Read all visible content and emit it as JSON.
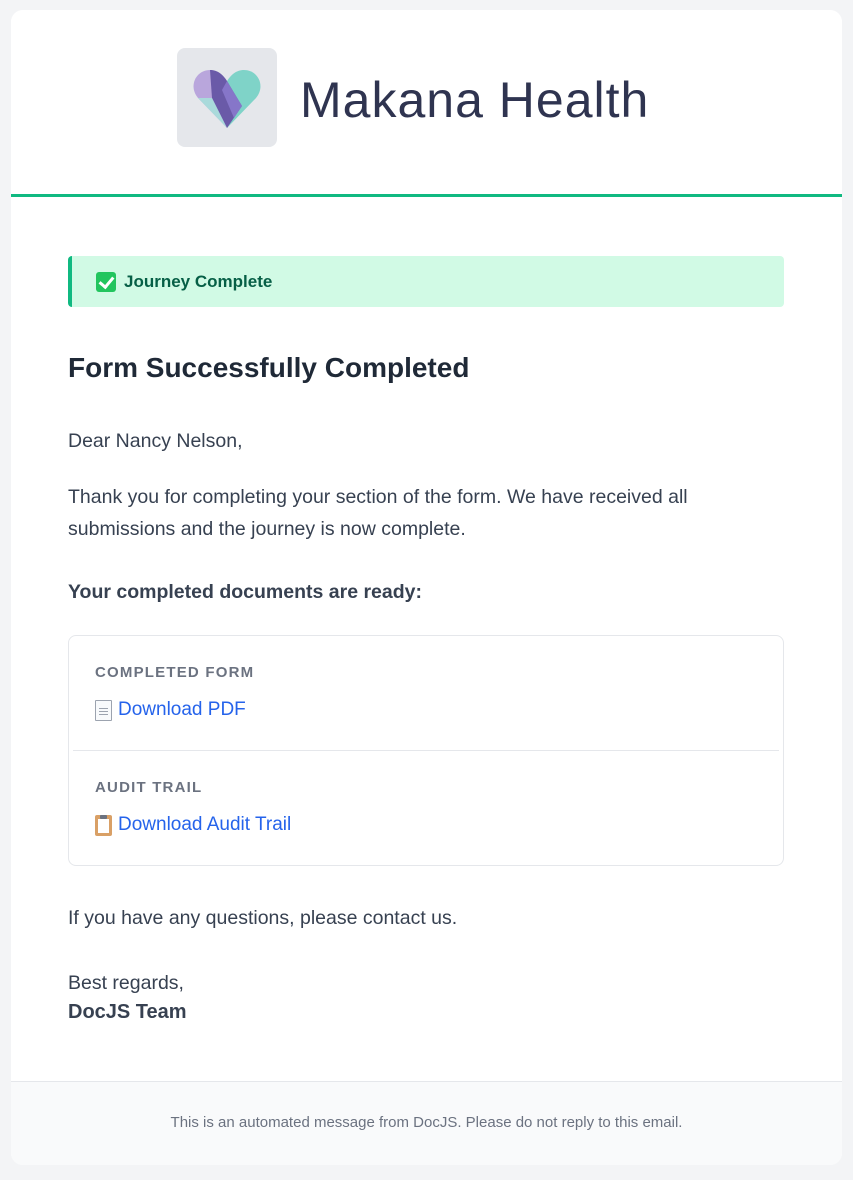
{
  "brand": {
    "name": "Makana Health",
    "logo_icon": "heart-logo-icon"
  },
  "status": {
    "icon": "check-box-icon",
    "label": "Journey Complete"
  },
  "email": {
    "title": "Form Successfully Completed",
    "greeting": "Dear Nancy Nelson,",
    "body": "Thank you for completing your section of the form. We have received all submissions and the journey is now complete.",
    "docs_heading": "Your completed documents are ready:",
    "documents": [
      {
        "label": "COMPLETED FORM",
        "icon": "page-icon",
        "link_text": "Download PDF"
      },
      {
        "label": "AUDIT TRAIL",
        "icon": "clipboard-icon",
        "link_text": "Download Audit Trail"
      }
    ],
    "closing": "If you have any questions, please contact us.",
    "regards": "Best regards,",
    "signature": "DocJS Team"
  },
  "footer": {
    "text": "This is an automated message from DocJS. Please do not reply to this email."
  },
  "colors": {
    "accent_green": "#10b981",
    "banner_bg": "#d1fae5",
    "link_blue": "#2563eb",
    "logo_purple": "#7c6cc4",
    "logo_teal": "#7fd3c8"
  }
}
